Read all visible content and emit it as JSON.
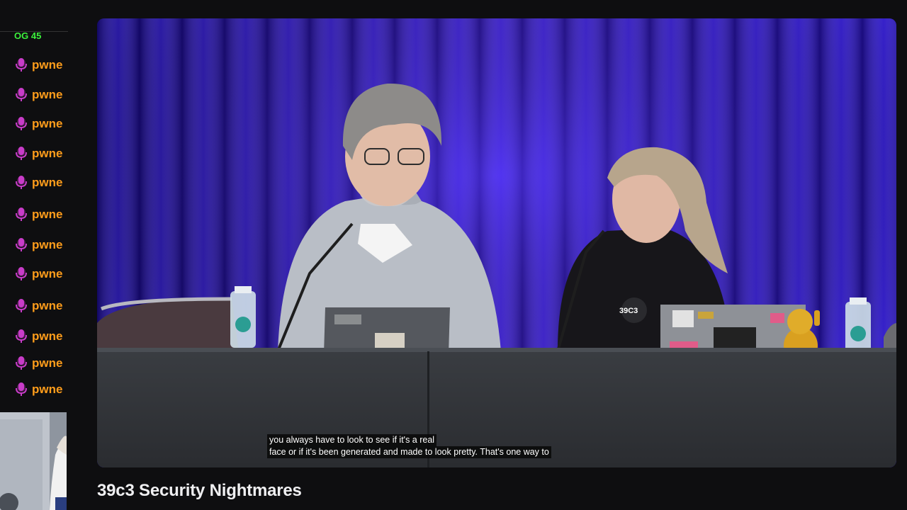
{
  "chat": {
    "cutoff_text": "OG 45",
    "messages": [
      {
        "user": "pwne"
      },
      {
        "user": "pwne"
      },
      {
        "user": "pwne"
      },
      {
        "user": "pwne"
      },
      {
        "user": "pwne"
      },
      {
        "user": "pwne"
      },
      {
        "user": "pwne"
      },
      {
        "user": "pwne"
      },
      {
        "user": "pwne"
      },
      {
        "user": "pwne"
      },
      {
        "user": "pwne"
      },
      {
        "user": "pwne"
      }
    ],
    "icon": "microphone-icon",
    "name_color": "#ff9d1b",
    "icon_color": "#c83cc8"
  },
  "video": {
    "captions": [
      "you always have to look to see if it's a real",
      "face or if it's been generated and made to look pretty. That's one way to"
    ],
    "stage_background": "#2a10c8"
  },
  "stream": {
    "title": "39c3 Security Nightmares"
  }
}
